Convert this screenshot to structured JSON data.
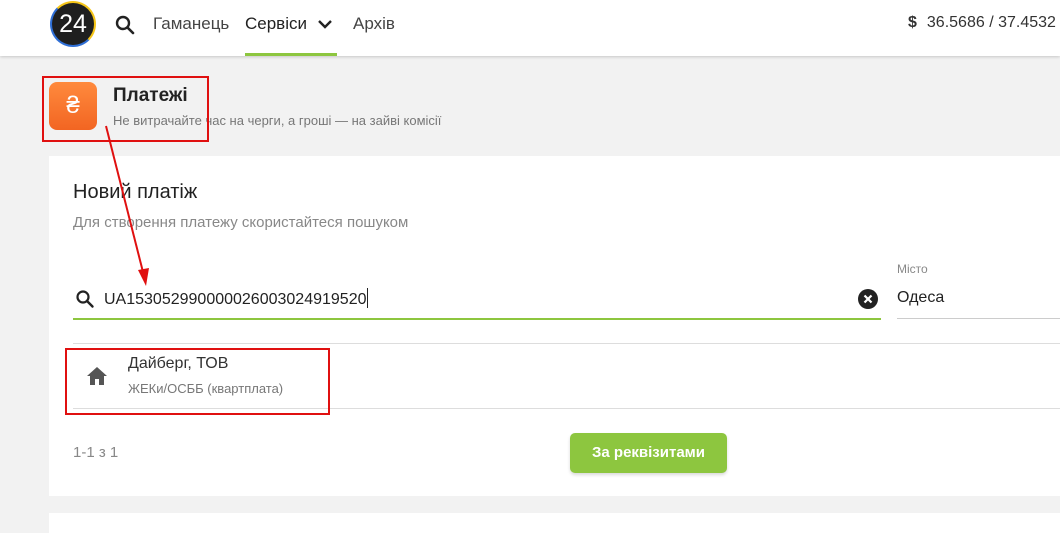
{
  "topbar": {
    "logo_text": "24",
    "search_icon": "search-icon",
    "nav": {
      "wallet": "Гаманець",
      "services": "Сервіси",
      "archive": "Архів"
    },
    "currency_symbol": "$",
    "currency_rate": "36.5686 / 37.4532"
  },
  "header": {
    "icon": "hryvnia-icon",
    "icon_glyph": "₴",
    "title": "Платежі",
    "subtitle": "Не витрачайте час на черги, а гроші — на зайві комісії"
  },
  "new_payment": {
    "title": "Новий платіж",
    "subtitle": "Для створення платежу скористайтеся пошуком",
    "search_value": "UA153052990000026003024919520",
    "city_label": "Місто",
    "city_value": "Одеса"
  },
  "results": [
    {
      "icon": "home-icon",
      "name": "Дайберг, ТОВ",
      "category": "ЖЕКи/ОСББ (квартплата)"
    }
  ],
  "pager": "1-1 з 1",
  "requisites_button": "За реквізитами",
  "colors": {
    "accent_green": "#8dc63f",
    "brand_orange": "#f26522",
    "annotation_red": "#e01010"
  }
}
